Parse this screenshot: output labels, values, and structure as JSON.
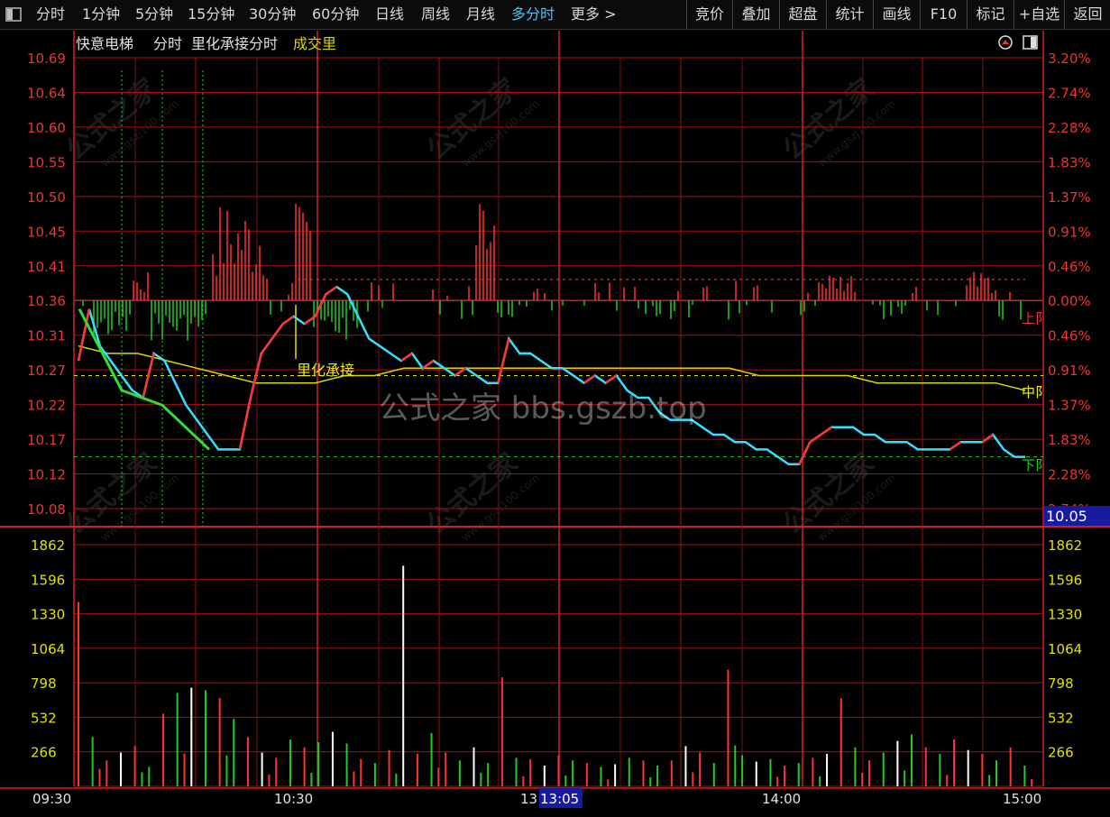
{
  "toolbar": {
    "left_icon": "window-toggle-icon",
    "tabs": [
      "分时",
      "1分钟",
      "5分钟",
      "15分钟",
      "30分钟",
      "60分钟",
      "日线",
      "周线",
      "月线",
      "多分时",
      "更多 >"
    ],
    "active_tab": "多分时",
    "right_buttons": [
      "竞价",
      "叠加",
      "超盘",
      "统计",
      "画线",
      "F10",
      "标记",
      "+自选",
      "返回"
    ]
  },
  "header": {
    "stock_name": "快意电梯",
    "mode": "分时",
    "indicator": "里化承接分时",
    "volume_label": "成交里",
    "icons": [
      "up-arrow-circle-icon",
      "panel-toggle-icon"
    ]
  },
  "annotations": {
    "support_label": "里化承接",
    "upper_tag": "上阝",
    "middle_tag": "中阝",
    "lower_tag": "下阝",
    "current_price": "10.05",
    "cursor_time": "13:05",
    "cursor_time_partial": "13"
  },
  "watermark": {
    "text": "公式之家",
    "url": "www.gszj100.com",
    "banner": "公式之家 bbs.gszb.top"
  },
  "colors": {
    "up": "#ff3333",
    "down": "#22cc22",
    "price_line": "#33e0ff",
    "avg_line": "#d8d800",
    "grid": "#aa1111",
    "flat": "#ffffff"
  },
  "chart_data": {
    "type": "line",
    "x_ticks": [
      "09:30",
      "10:30",
      "14:00",
      "15:00"
    ],
    "price_axis": {
      "ticks": [
        "10.69",
        "10.64",
        "10.60",
        "10.55",
        "10.50",
        "10.45",
        "10.41",
        "10.36",
        "10.31",
        "10.27",
        "10.22",
        "10.17",
        "10.12",
        "10.08"
      ],
      "pct_ticks": [
        "3.20%",
        "2.74%",
        "2.28%",
        "1.83%",
        "1.37%",
        "0.91%",
        "0.46%",
        "0.00%",
        "0.46%",
        "0.91%",
        "1.37%",
        "1.83%",
        "2.28%",
        "2.74%"
      ],
      "prev_close": 10.36
    },
    "volume_axis": {
      "ticks": [
        "1862",
        "1596",
        "1330",
        "1064",
        "798",
        "532",
        "266"
      ]
    },
    "series": [
      {
        "values": [
          10.28,
          10.35,
          10.3,
          10.28,
          10.26,
          10.24,
          10.23,
          10.29,
          10.28,
          10.25,
          10.22,
          10.2,
          10.18,
          10.16,
          10.16,
          10.16,
          10.23,
          10.29,
          10.31,
          10.33,
          10.34,
          10.33,
          10.34,
          10.37,
          10.38,
          10.37,
          10.34,
          10.31,
          10.3,
          10.29,
          10.28,
          10.29,
          10.27,
          10.28,
          10.27,
          10.26,
          10.27,
          10.26,
          10.25,
          10.25,
          10.31,
          10.29,
          10.29,
          10.28,
          10.27,
          10.27,
          10.26,
          10.25,
          10.26,
          10.25,
          10.26,
          10.24,
          10.23,
          10.23,
          10.21,
          10.2,
          10.2,
          10.2,
          10.19,
          10.18,
          10.18,
          10.17,
          10.17,
          10.16,
          10.16,
          10.15,
          10.14,
          10.14,
          10.17,
          10.18,
          10.19,
          10.19,
          10.19,
          10.18,
          10.18,
          10.17,
          10.17,
          10.17,
          10.16,
          10.16,
          10.16,
          10.16,
          10.17,
          10.17,
          10.17,
          10.18,
          10.16,
          10.15,
          10.15
        ]
      },
      {
        "values": [
          10.3,
          10.29,
          10.29,
          10.28,
          10.27,
          10.26,
          10.25,
          10.25,
          10.25,
          10.26,
          10.26,
          10.27,
          10.27,
          10.27,
          10.27,
          10.27,
          10.27,
          10.27,
          10.27,
          10.27,
          10.27,
          10.27,
          10.27,
          10.26,
          10.26,
          10.26,
          10.26,
          10.25,
          10.25,
          10.25,
          10.25,
          10.25,
          10.24
        ]
      }
    ],
    "volume_values": [
      1420,
      380,
      200,
      260,
      310,
      150,
      560,
      720,
      760,
      740,
      680,
      520,
      380,
      260,
      220,
      360,
      300,
      340,
      420,
      330,
      210,
      180,
      280,
      1700,
      250,
      410,
      260,
      200,
      300,
      180,
      840,
      220,
      210,
      160,
      240,
      200,
      180,
      150,
      170,
      220,
      200,
      160,
      200,
      310,
      260,
      180,
      900,
      240,
      190,
      210,
      160,
      180,
      220,
      250,
      680,
      300,
      200,
      260,
      350,
      400,
      300,
      250,
      360,
      280,
      250,
      200,
      300,
      160
    ]
  }
}
